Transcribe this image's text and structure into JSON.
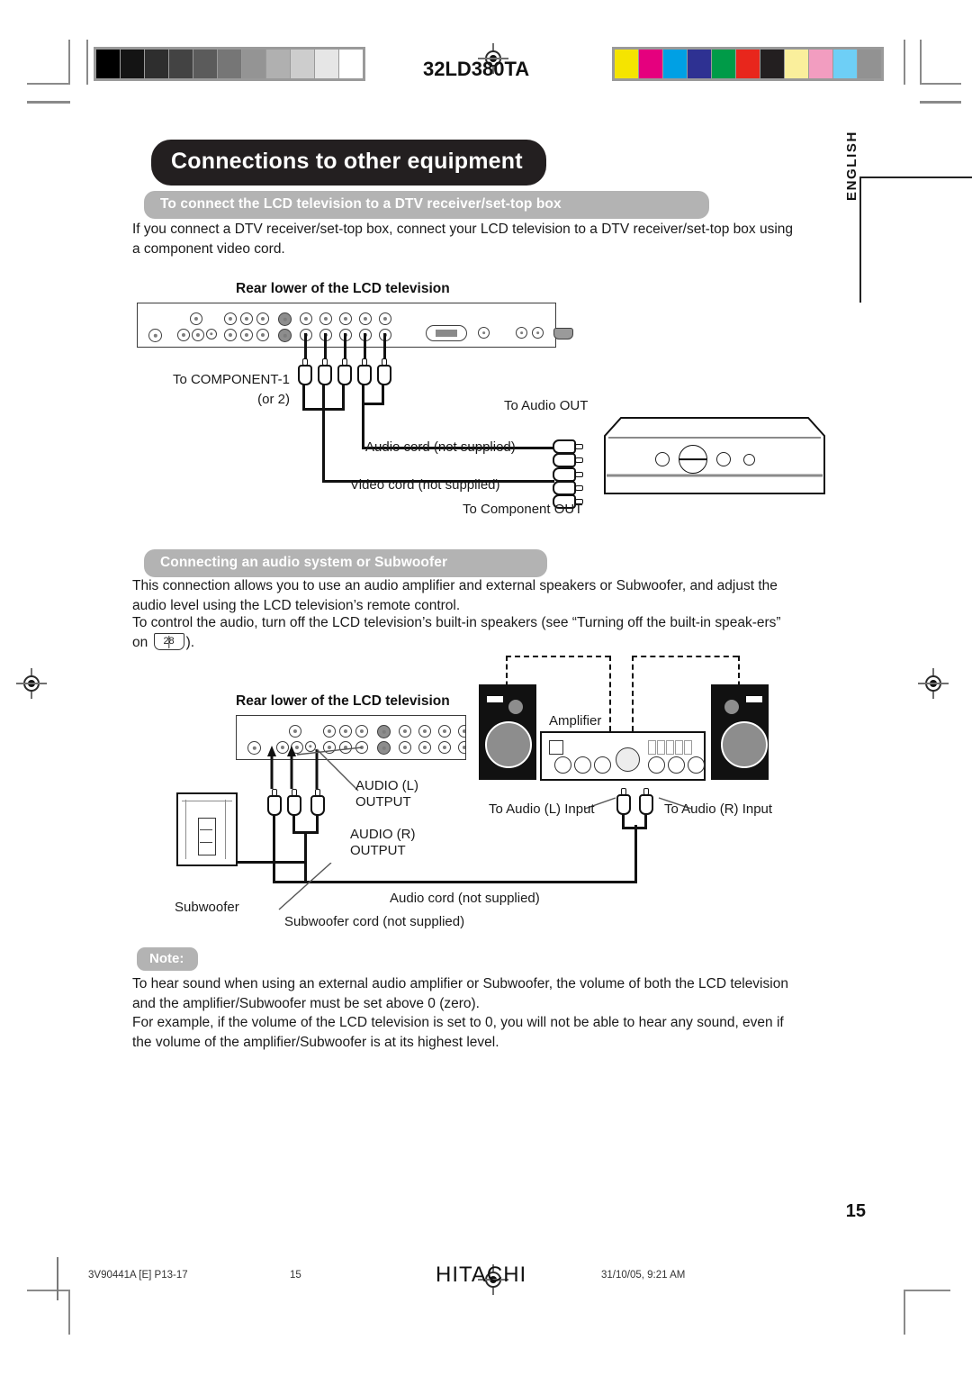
{
  "print_marks": {
    "model_code": "32LD380TA",
    "grayscale_patches": [
      "#000000",
      "#141414",
      "#2e2e2e",
      "#434343",
      "#5b5b5b",
      "#767676",
      "#949494",
      "#b0b0b0",
      "#cdcdcd",
      "#e6e6e6",
      "#ffffff"
    ],
    "color_patches": [
      "#f5e400",
      "#e5007e",
      "#00a0e4",
      "#2e3192",
      "#009b48",
      "#e8261c",
      "#231f20",
      "#faef9c",
      "#f29dc0",
      "#6ecff6",
      "#929292"
    ]
  },
  "side_tab": {
    "label": "ENGLISH"
  },
  "chapter": {
    "title": "Connections to other equipment"
  },
  "section_dtv": {
    "heading": "To connect the LCD television to a DTV receiver/set-top box",
    "body": "If you connect a DTV receiver/set-top box, connect your LCD television to a DTV receiver/set-top box using a component video cord.",
    "diagram_title": "Rear lower of the LCD television",
    "labels": {
      "component": "To COMPONENT-1",
      "component2": "(or 2)",
      "audio_out": "To Audio OUT",
      "audio_cord": "Audio cord (not supplied)",
      "video_cord": "Video cord (not supplied)",
      "component_out": "To Component OUT"
    }
  },
  "section_audio": {
    "heading": "Connecting an audio system or Subwoofer",
    "body_1": "This connection allows you to use an audio amplifier and external speakers or Subwoofer, and adjust the audio level using the LCD television’s remote control.",
    "body_2_pre": "To control the audio, turn off the LCD television’s built-in speakers (see “Turning off the built-in speak-ers” on ",
    "page_ref": "28",
    "body_2_post": ").",
    "diagram_title": "Rear lower of the LCD television",
    "labels": {
      "audio_l": "AUDIO (L)",
      "audio_l_2": "OUTPUT",
      "audio_r": "AUDIO (R)",
      "audio_r_2": "OUTPUT",
      "amplifier": "Amplifier",
      "to_audio_l_input": "To Audio (L) Input",
      "to_audio_r_input": "To Audio (R) Input",
      "subwoofer": "Subwoofer",
      "audio_cord": "Audio cord (not supplied)",
      "subwoofer_cord": "Subwoofer cord (not supplied)"
    }
  },
  "note": {
    "heading": "Note:",
    "body_1": "To hear sound when using an external audio amplifier or Subwoofer, the volume of both the LCD television and the amplifier/Subwoofer must be set above 0 (zero).",
    "body_2": "For example, if the volume of the LCD television is set to 0, you will not be able to hear any sound, even if the volume of the amplifier/Subwoofer is at its highest level."
  },
  "page_number": "15",
  "footer": {
    "doc_code": "3V90441A [E] P13-17",
    "page": "15",
    "brand": "HITACHI",
    "timestamp": "31/10/05, 9:21 AM"
  }
}
